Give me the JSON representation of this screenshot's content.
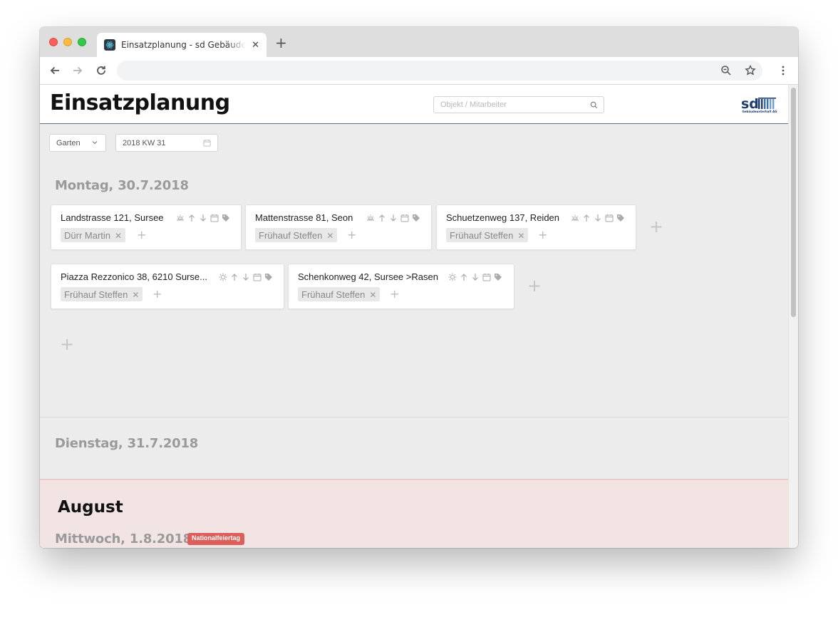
{
  "browser": {
    "tab_title": "Einsatzplanung - sd Gebäudeunterhalt AG",
    "tab_close": "✕",
    "new_tab": "+",
    "address": ""
  },
  "app": {
    "title": "Einsatzplanung",
    "search_placeholder": "Objekt / Mitarbeiter",
    "logo_text": "sd",
    "logo_caption": "Gebäudeunterhalt AG"
  },
  "filters": {
    "group": "Garten",
    "week": "2018 KW 31"
  },
  "days": [
    {
      "title": "Montag, 30.7.2018",
      "assignments": [
        {
          "address": "Landstrasse 121, Sursee",
          "weather": "cloud-sun",
          "employees": [
            "Dürr Martin"
          ]
        },
        {
          "address": "Mattenstrasse 81, Seon",
          "weather": "cloud-sun",
          "employees": [
            "Frühauf Steffen"
          ]
        },
        {
          "address": "Schuetzenweg 137, Reiden",
          "weather": "cloud-sun",
          "employees": [
            "Frühauf Steffen"
          ]
        },
        {
          "address": "Piazza Rezzonico 38, 6210 Surse...",
          "weather": "sun",
          "employees": [
            "Frühauf Steffen"
          ]
        },
        {
          "address": "Schenkonweg 42, Sursee >Rasen",
          "weather": "sun",
          "employees": [
            "Frühauf Steffen"
          ]
        }
      ],
      "add_label": "+"
    },
    {
      "title": "Dienstag, 31.7.2018",
      "assignments": []
    }
  ],
  "month": {
    "title": "August",
    "day_title": "Mittwoch, 1.8.2018",
    "holiday_badge": "Nationalfeiertag"
  },
  "colors": {
    "accent_line": "#5d7182",
    "holiday_bg": "#f3e4e4",
    "holiday_badge": "#dc5f5c",
    "logo_blue": "#1c3c6e"
  }
}
